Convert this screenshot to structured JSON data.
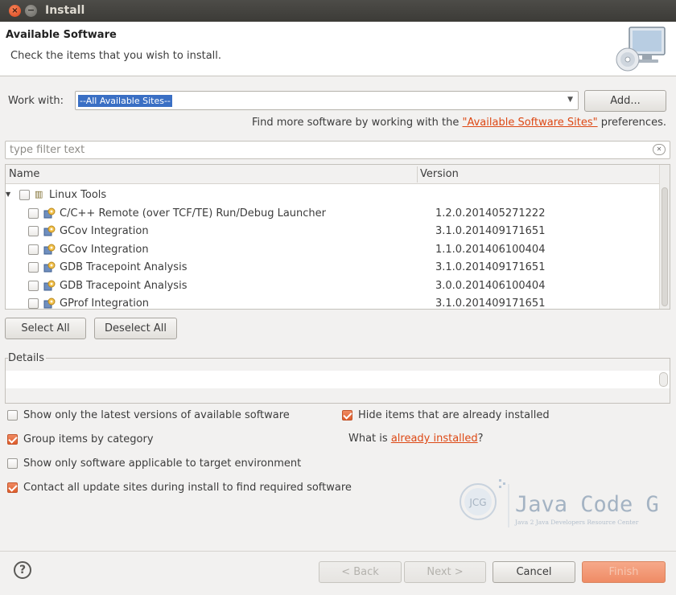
{
  "window": {
    "title": "Install",
    "close_glyph": "×",
    "minimize_glyph": "−"
  },
  "banner": {
    "title": "Available Software",
    "subtitle": "Check the items that you wish to install.",
    "icon": "monitor-cd-icon"
  },
  "work_with": {
    "label": "Work with:",
    "value": "--All Available Sites--",
    "add_label": "Add...",
    "hint_prefix": "Find more software by working with the ",
    "hint_link": "\"Available Software Sites\"",
    "hint_suffix": " preferences."
  },
  "filter": {
    "placeholder": "type filter text"
  },
  "tree": {
    "columns": {
      "name": "Name",
      "version": "Version"
    },
    "category": {
      "name": "Linux Tools",
      "checked": false,
      "icon": "category-icon"
    },
    "items": [
      {
        "name": "C/C++ Remote (over TCF/TE) Run/Debug Launcher",
        "version": "1.2.0.201405271222",
        "checked": false
      },
      {
        "name": "GCov Integration",
        "version": "3.1.0.201409171651",
        "checked": false
      },
      {
        "name": "GCov Integration",
        "version": "1.1.0.201406100404",
        "checked": false
      },
      {
        "name": "GDB Tracepoint Analysis",
        "version": "3.1.0.201409171651",
        "checked": false
      },
      {
        "name": "GDB Tracepoint Analysis",
        "version": "3.0.0.201406100404",
        "checked": false
      },
      {
        "name": "GProf Integration",
        "version": "3.1.0.201409171651",
        "checked": false
      }
    ]
  },
  "selection": {
    "select_all": "Select All",
    "deselect_all": "Deselect All"
  },
  "details": {
    "label": "Details"
  },
  "options": {
    "latest_only": {
      "label": "Show only the latest versions of available software",
      "checked": false
    },
    "hide_installed": {
      "label": "Hide items that are already installed",
      "checked": true
    },
    "group_by_category": {
      "label": "Group items by category",
      "checked": true
    },
    "what_is_prefix": "What is ",
    "what_is_link": "already installed",
    "what_is_suffix": "?",
    "target_env_only": {
      "label": "Show only software applicable to target environment",
      "checked": false
    },
    "contact_sites": {
      "label": "Contact all update sites during install to find required software",
      "checked": true
    }
  },
  "logo": {
    "initials": "JCG",
    "title": "Java Code Geeks",
    "tagline": "Java 2 Java Developers Resource Center"
  },
  "footer": {
    "help_glyph": "?",
    "back_label": "< Back",
    "next_label": "Next >",
    "cancel_label": "Cancel",
    "finish_label": "Finish"
  },
  "colors": {
    "accent": "#dd4814",
    "selection": "#3a6fc4",
    "checkbox_on": "#df5d2c"
  }
}
